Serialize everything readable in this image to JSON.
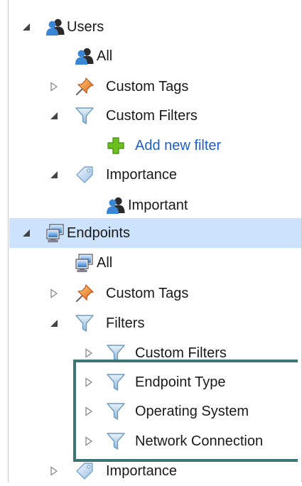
{
  "tree": {
    "users": {
      "label": "Users"
    },
    "users_all": {
      "label": "All"
    },
    "users_custom_tags": {
      "label": "Custom Tags"
    },
    "users_custom_filters": {
      "label": "Custom Filters"
    },
    "users_add_new_filter": {
      "label": "Add new filter"
    },
    "users_importance": {
      "label": "Importance"
    },
    "users_important": {
      "label": "Important"
    },
    "endpoints": {
      "label": "Endpoints"
    },
    "endpoints_all": {
      "label": "All"
    },
    "endpoints_custom_tags": {
      "label": "Custom Tags"
    },
    "endpoints_filters": {
      "label": "Filters"
    },
    "endpoints_custom_filters": {
      "label": "Custom Filters"
    },
    "endpoint_type": {
      "label": "Endpoint Type"
    },
    "operating_system": {
      "label": "Operating System"
    },
    "network_connection": {
      "label": "Network Connection"
    },
    "endpoints_importance": {
      "label": "Importance"
    }
  },
  "icons": {
    "users": "users-group-icon",
    "tag": "pushpin-icon",
    "filter": "funnel-icon",
    "add": "plus-icon",
    "importance": "tag-label-icon",
    "endpoints": "computer-monitor-icon"
  },
  "colors": {
    "selected_row": "#cde3fb",
    "link": "#1f5fc8",
    "highlight_border": "#3d7474"
  }
}
